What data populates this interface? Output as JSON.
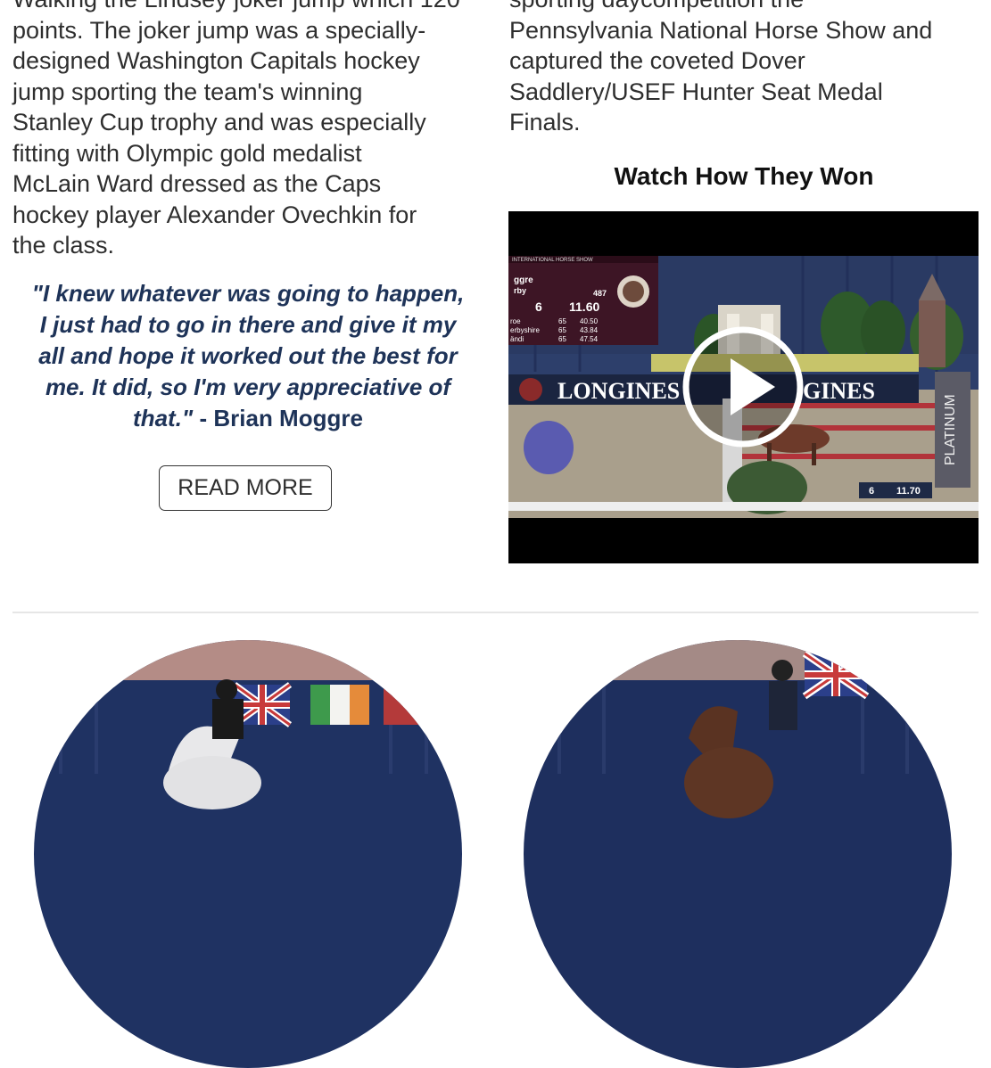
{
  "left_column": {
    "paragraph_lines": [
      "Walking the Lindsey joker jump which 120",
      "points. The joker jump was a specially-",
      "designed Washington Capitals hockey",
      "jump sporting the team's winning",
      "Stanley Cup trophy and was especially",
      "fitting with Olympic gold medalist",
      "McLain Ward dressed as the Caps",
      "hockey player Alexander Ovechkin for",
      "the class."
    ],
    "quote_lines": [
      "\"I knew whatever was going to happen,",
      "I just had to go in there and give it my",
      "all and hope it worked out the best for",
      "me. It did, so I'm very appreciative of"
    ],
    "quote_last_line": "that.\"",
    "quote_author": " - Brian Moggre",
    "read_more_label": "READ MORE"
  },
  "right_column": {
    "paragraph_lines": [
      "sporting daycompetition the",
      "Pennsylvania National Horse Show and",
      "captured the coveted Dover",
      "Saddlery/USEF Hunter Seat Medal",
      "Finals."
    ],
    "video_heading": "Watch How They Won",
    "video": {
      "scoreboard_header": "INTERNATIONAL HORSE SHOW",
      "scoreboard_rows": [
        {
          "name": "ggre",
          "score": "",
          "time": ""
        },
        {
          "name": "rby",
          "score": "487",
          "time": ""
        },
        {
          "name": "6",
          "score": "11.60",
          "time": ""
        },
        {
          "name": "roe",
          "score": "65",
          "time": "40.50"
        },
        {
          "name": "erbyshire",
          "score": "65",
          "time": "43.84"
        },
        {
          "name": "ändi",
          "score": "65",
          "time": "47.54"
        }
      ],
      "banner_text": "LONGINES",
      "banner_text_2": "GINES",
      "side_banner": "PLATINUM",
      "timer_left": "6",
      "timer_right": "11.70",
      "play_icon": "play-icon"
    }
  },
  "colors": {
    "quote": "#1e3358",
    "body_text": "#2e2e2e",
    "heading": "#111111",
    "divider": "#e6e6e6"
  }
}
